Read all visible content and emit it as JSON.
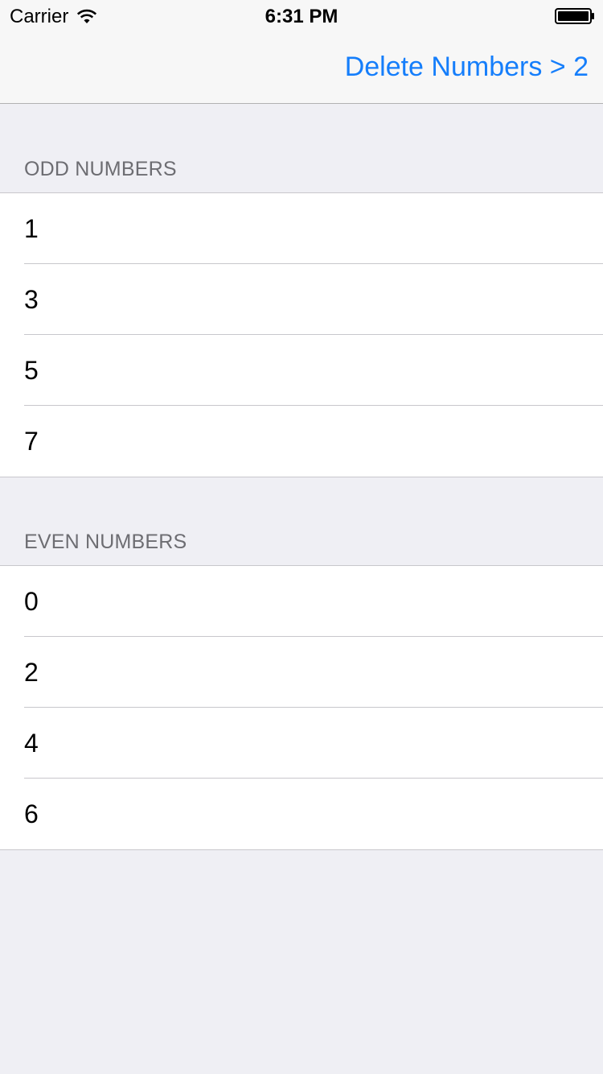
{
  "status_bar": {
    "carrier": "Carrier",
    "time": "6:31 PM"
  },
  "nav": {
    "right_button_label": "Delete Numbers > 2"
  },
  "sections": [
    {
      "header": "ODD NUMBERS",
      "rows": [
        "1",
        "3",
        "5",
        "7"
      ]
    },
    {
      "header": "EVEN NUMBERS",
      "rows": [
        "0",
        "2",
        "4",
        "6"
      ]
    }
  ],
  "colors": {
    "tint": "#157efb",
    "grouped_background": "#efeff4",
    "header_text": "#6d6d72",
    "separator": "#c8c7cc"
  }
}
